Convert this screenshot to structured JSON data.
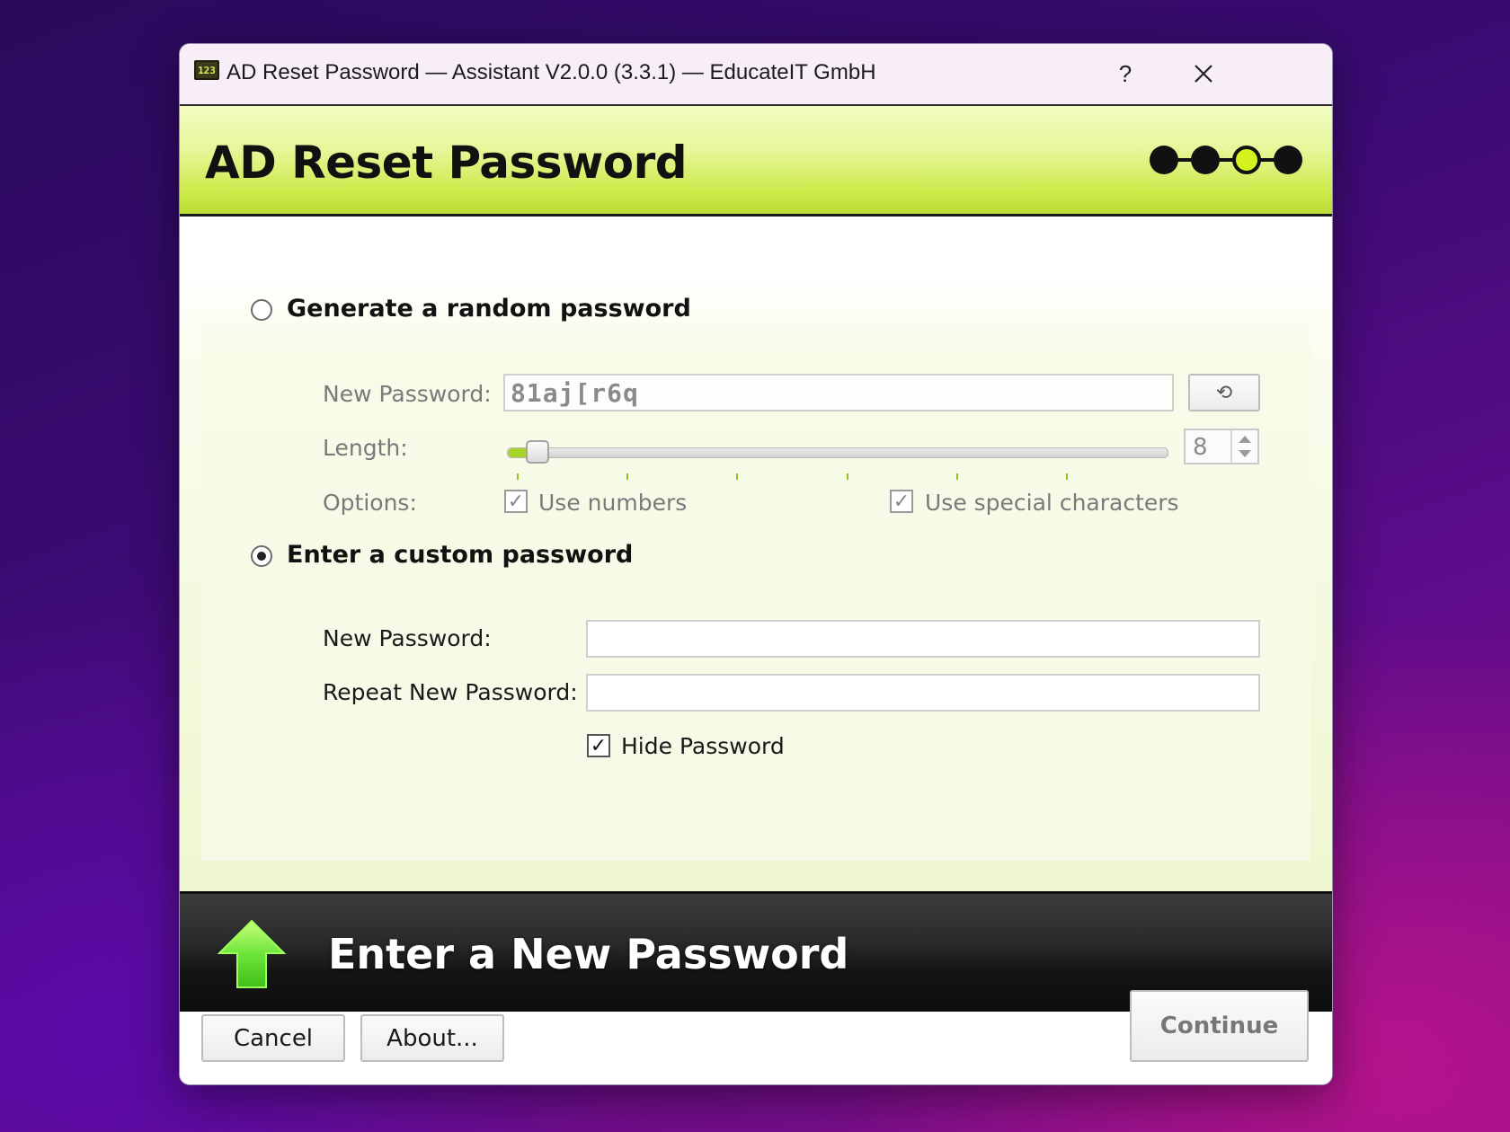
{
  "window": {
    "title": "AD Reset Password — Assistant V2.0.0 (3.3.1) — EducateIT GmbH",
    "app_icon_text": "123",
    "help_label": "?",
    "close_label": "✕"
  },
  "header": {
    "title": "AD Reset Password",
    "steps_total": 4,
    "current_step": 3
  },
  "random": {
    "radio_label": "Generate a random password",
    "selected": false,
    "new_password_label": "New Password:",
    "new_password_value": "81aj[r6q",
    "regenerate_icon": "refresh-icon",
    "regenerate_glyph": "⟲",
    "length_label": "Length:",
    "length_value": "8",
    "options_label": "Options:",
    "use_numbers_label": "Use numbers",
    "use_numbers_checked": true,
    "use_special_label": "Use special characters",
    "use_special_checked": true
  },
  "custom": {
    "radio_label": "Enter a custom password",
    "selected": true,
    "new_password_label": "New Password:",
    "new_password_value": "",
    "repeat_label": "Repeat New Password:",
    "repeat_value": "",
    "hide_label": "Hide Password",
    "hide_checked": true
  },
  "banner": {
    "title": "Enter a New Password",
    "icon": "up-arrow-icon"
  },
  "buttons": {
    "cancel": "Cancel",
    "about": "About...",
    "continue": "Continue"
  },
  "colors": {
    "accent_green": "#c8e83e",
    "active_step": "#d4f21e",
    "arrow_green": "#5fdc2a"
  },
  "check_glyph": "✓"
}
